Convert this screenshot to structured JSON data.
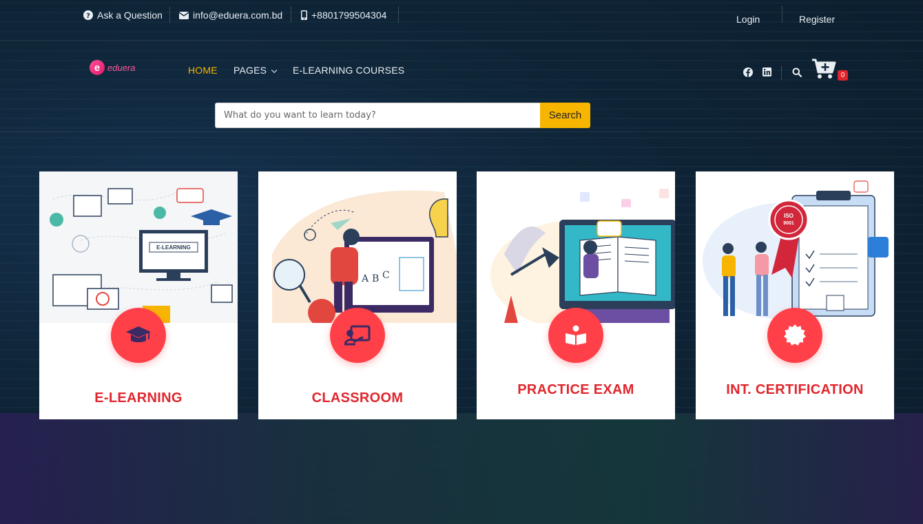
{
  "topbar": {
    "ask": "Ask a Question",
    "email": "info@eduera.com.bd",
    "phone": "+8801799504304",
    "login": "Login",
    "register": "Register"
  },
  "brand": {
    "letter": "e",
    "name": "eduera"
  },
  "nav": {
    "home": "HOME",
    "pages": "PAGES",
    "courses": "E-LEARNING COURSES",
    "cart_count": "0"
  },
  "search": {
    "placeholder": "What do you want to learn today?",
    "button": "Search"
  },
  "cards": [
    {
      "title": "E-LEARNING",
      "icon": "graduation-cap-icon"
    },
    {
      "title": "CLASSROOM",
      "icon": "chalkboard-teacher-icon"
    },
    {
      "title": "PRACTICE EXAM",
      "icon": "book-reader-icon"
    },
    {
      "title": "INT. CERTIFICATION",
      "icon": "certificate-icon"
    }
  ],
  "colors": {
    "accent": "#f7b500",
    "brand_red": "#e0262d",
    "badge_red": "#ff4048",
    "logo_pink": "#ff5aa0"
  },
  "illustration_text": {
    "elearning_screen": "E-LEARNING",
    "iso": "ISO",
    "iso_number": "9001"
  }
}
